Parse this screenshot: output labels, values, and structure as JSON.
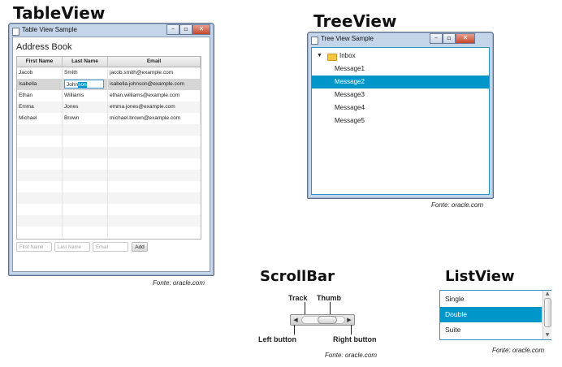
{
  "headings": {
    "tableview": "TableView",
    "treeview": "TreeView",
    "scrollbar": "ScrollBar",
    "listview": "ListView"
  },
  "caption": "Fonte: oracle.com",
  "table_window": {
    "title": "Table View Sample",
    "heading": "Address Book",
    "columns": [
      "First Name",
      "Last Name",
      "Email"
    ],
    "rows": [
      [
        "Jacob",
        "Smith",
        "jacob.smith@example.com"
      ],
      [
        "Isabella",
        "",
        "isabella.johnson@example.com"
      ],
      [
        "Ethan",
        "Williams",
        "ethan.williams@example.com"
      ],
      [
        "Emma",
        "Jones",
        "emma.jones@example.com"
      ],
      [
        "Michael",
        "Brown",
        "michael.brown@example.com"
      ]
    ],
    "editing": {
      "text_plain": "John",
      "text_selected": "son"
    },
    "add_fields": {
      "first": "First Name",
      "last": "Last Name",
      "email": "Email",
      "button": "Add"
    }
  },
  "tree_window": {
    "title": "Tree View Sample",
    "root": "Inbox",
    "items": [
      "Message1",
      "Message2",
      "Message3",
      "Message4",
      "Message5"
    ],
    "selected_index": 1
  },
  "scrollbar": {
    "labels": {
      "track": "Track",
      "thumb": "Thumb",
      "left": "Left button",
      "right": "Right button"
    }
  },
  "listview": {
    "items": [
      "Single",
      "Double",
      "Suite"
    ],
    "selected_index": 1
  },
  "colors": {
    "selection": "#0096c9",
    "window_frame": "#c4d5ea"
  }
}
